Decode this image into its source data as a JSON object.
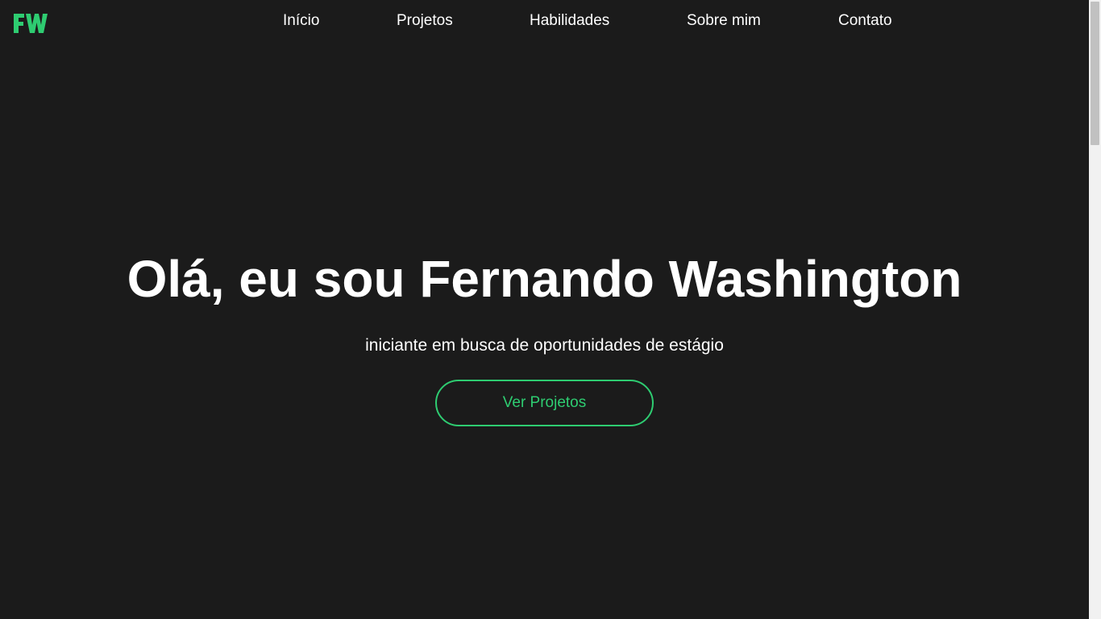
{
  "brand": {
    "logo_icon": "fw-monogram-logo",
    "accent_color": "#2ecc71"
  },
  "nav": {
    "items": [
      {
        "label": "Início"
      },
      {
        "label": "Projetos"
      },
      {
        "label": "Habilidades"
      },
      {
        "label": "Sobre mim"
      },
      {
        "label": "Contato"
      }
    ]
  },
  "hero": {
    "title": "Olá, eu sou Fernando Washington",
    "subtitle": "iniciante em busca de oportunidades de estágio",
    "cta_label": "Ver Projetos"
  },
  "colors": {
    "background": "#1b1b1b",
    "text": "#ffffff",
    "accent": "#2ecc71"
  }
}
